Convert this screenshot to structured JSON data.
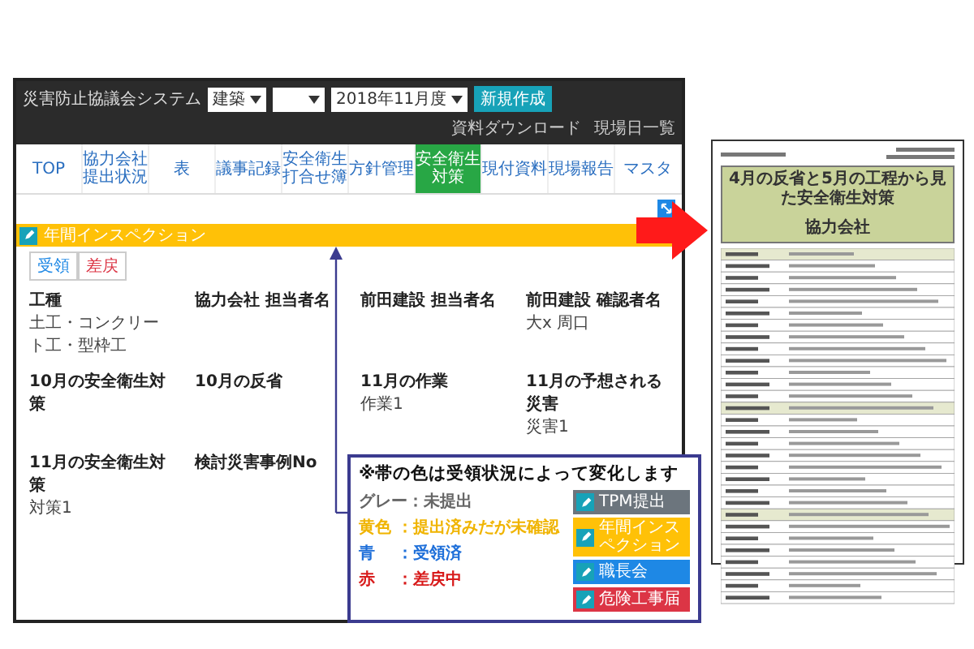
{
  "app": {
    "title": "災害防止協議会システム",
    "site_select": "建築",
    "month_select": "2018年11月度",
    "new_button": "新規作成",
    "links": [
      "資料ダウンロード",
      "現場日一覧"
    ],
    "nav": [
      {
        "label": "TOP",
        "selected": false
      },
      {
        "label": "協力会社提出状況",
        "selected": false
      },
      {
        "label": "表",
        "selected": false
      },
      {
        "label": "議事記録",
        "selected": false
      },
      {
        "label": "安全衛生打合せ簿",
        "selected": false
      },
      {
        "label": "方針管理",
        "selected": false
      },
      {
        "label": "安全衛生対策",
        "selected": true
      },
      {
        "label": "現付資料",
        "selected": false
      },
      {
        "label": "現場報告",
        "selected": false
      },
      {
        "label": "マスタ",
        "selected": false
      }
    ],
    "band": {
      "title": "年間インスペクション",
      "color": "#ffc107"
    },
    "actions": [
      {
        "label": "受領",
        "kind": "accept"
      },
      {
        "label": "差戻",
        "kind": "return"
      }
    ],
    "fields": [
      {
        "label": "工種",
        "value": "土工・コンクリート工・型枠工"
      },
      {
        "label": "協力会社 担当者名"
      },
      {
        "label": "前田建設 担当者名"
      },
      {
        "label": "前田建設 確認者名",
        "value": "大x 周口"
      },
      {
        "label": "10月の安全衛生対策"
      },
      {
        "label": "10月の反省"
      },
      {
        "label": "11月の作業",
        "value": "作業1"
      },
      {
        "label": "11月の予想される災害",
        "value": "災害1"
      },
      {
        "label": "11月の安全衛生対策",
        "value": "対策1"
      },
      {
        "label": "検討災害事例No"
      }
    ]
  },
  "callout": {
    "note": "※帯の色は受領状況によって変化します",
    "legend": [
      {
        "text": "グレー：未提出",
        "color": "#666666"
      },
      {
        "text": "黄色 ：提出済みだが未確認",
        "color": "#f0b400"
      },
      {
        "text": "青 　：受領済",
        "color": "#1e6fd9"
      },
      {
        "text": "赤 　：差戻中",
        "color": "#d81b1b"
      }
    ],
    "bars": [
      {
        "label": "TPM提出",
        "color": "#6c757d"
      },
      {
        "label": "年間インスペクション",
        "color": "#ffc107"
      },
      {
        "label": "職長会",
        "color": "#1e88e5"
      },
      {
        "label": "危険工事届",
        "color": "#dc3545"
      }
    ]
  },
  "document": {
    "title": "4月の反省と5月の工程から見た安全衛生対策",
    "subtitle": "協力会社"
  }
}
